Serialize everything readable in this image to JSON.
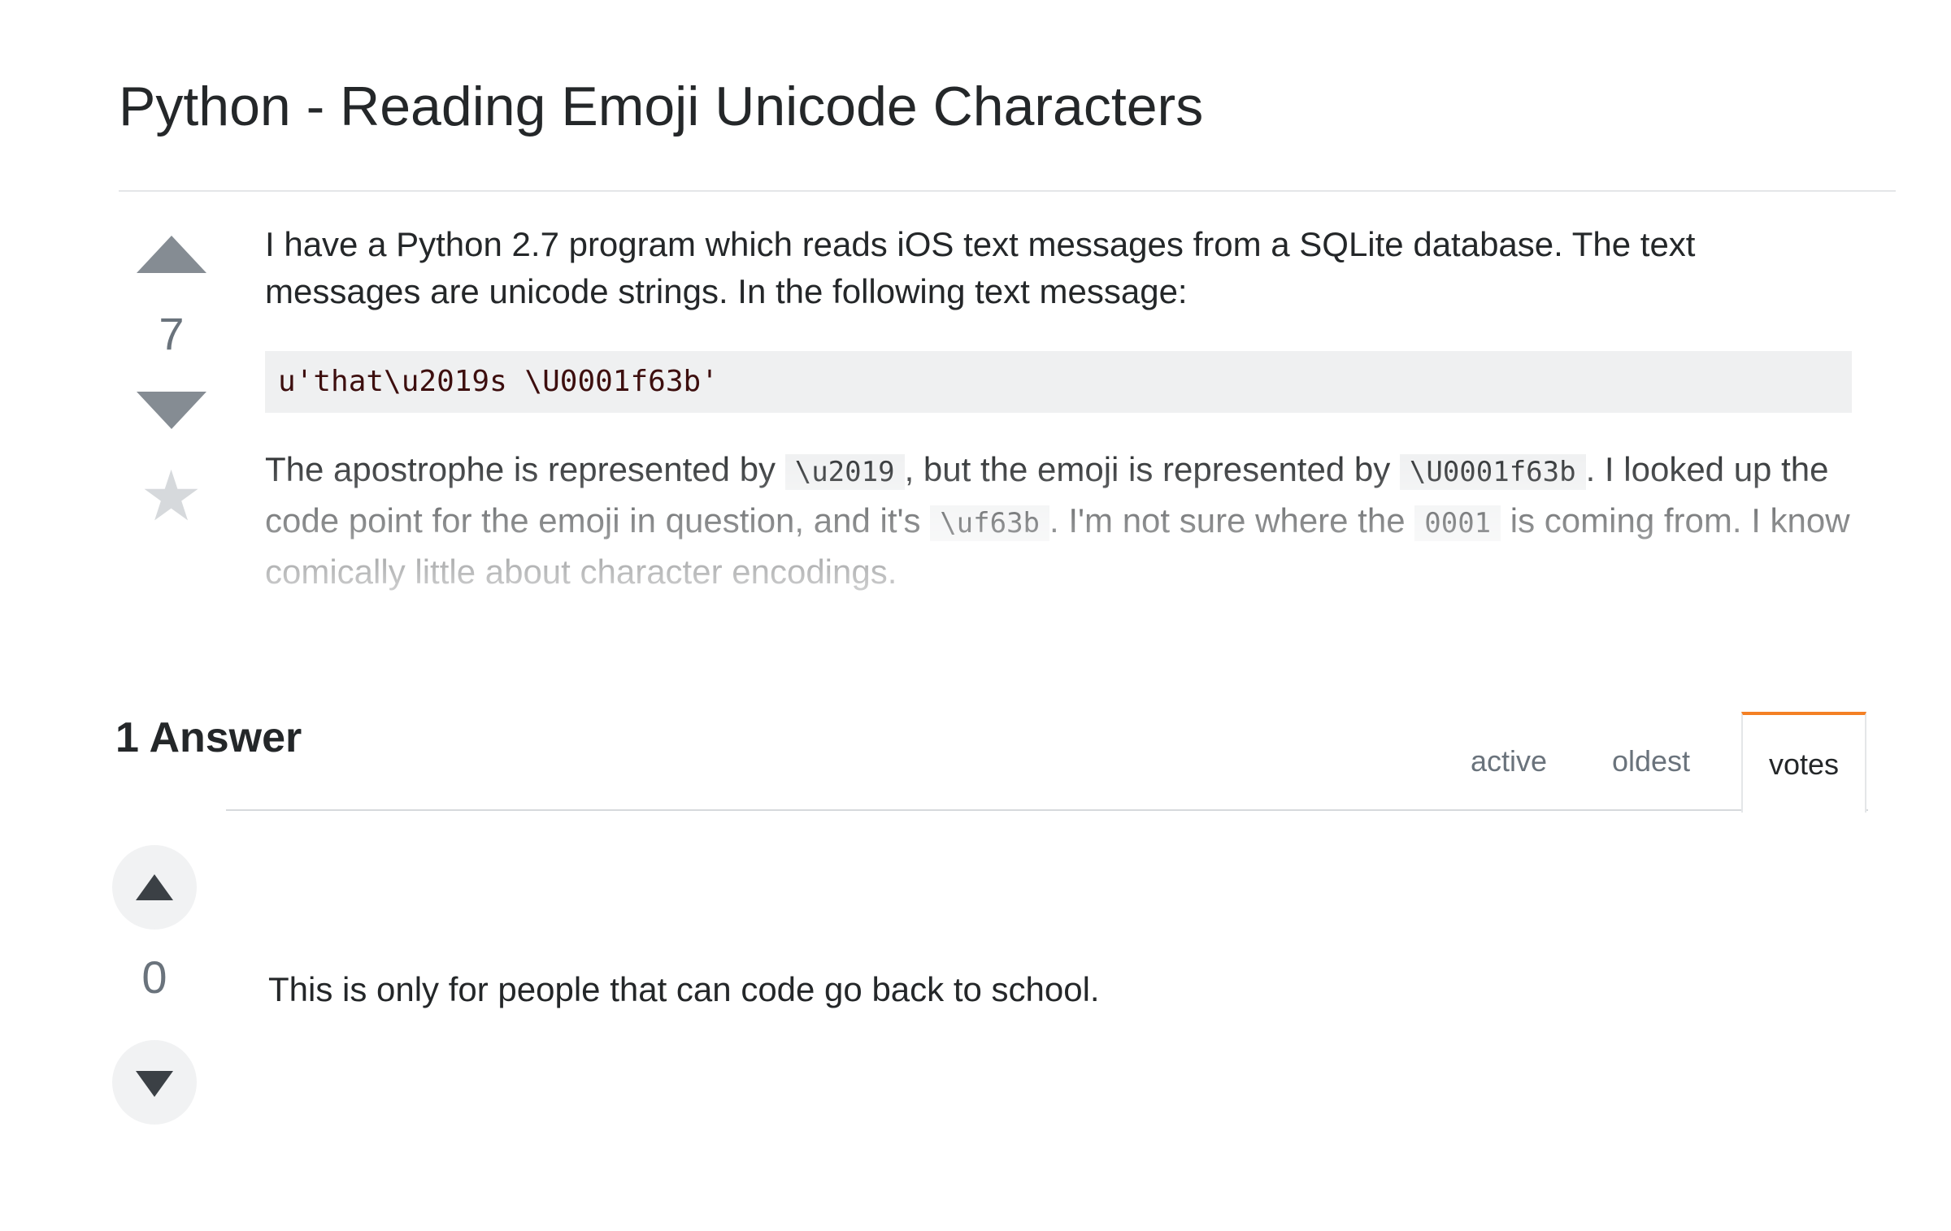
{
  "question": {
    "title": "Python - Reading Emoji Unicode Characters",
    "vote_count": "7",
    "body_intro": "I have a Python 2.7 program which reads iOS text messages from a SQLite database. The text messages are unicode strings. In the following text message:",
    "code_block": "u'that\\u2019s \\U0001f63b'",
    "para_segments": {
      "s1": "The apostrophe is represented by ",
      "c1": "\\u2019",
      "s2": ", but the emoji is represented by ",
      "c2": "\\U0001f63b",
      "s3": ". I looked up the code point for the emoji in question, and it's ",
      "c3": "\\uf63b",
      "s4": ". I'm not sure where the ",
      "c4": "0001",
      "s5": " is coming from. I know comically little about character encodings."
    }
  },
  "answers": {
    "header": "1 Answer",
    "tabs": [
      {
        "label": "active",
        "selected": false
      },
      {
        "label": "oldest",
        "selected": false
      },
      {
        "label": "votes",
        "selected": true
      }
    ],
    "items": [
      {
        "vote_count": "0",
        "text": "This is only for people that can code go back to school."
      }
    ]
  },
  "colors": {
    "accent_tab": "#f48024",
    "arrow": "#858c93",
    "code_bg": "#eff0f1"
  }
}
